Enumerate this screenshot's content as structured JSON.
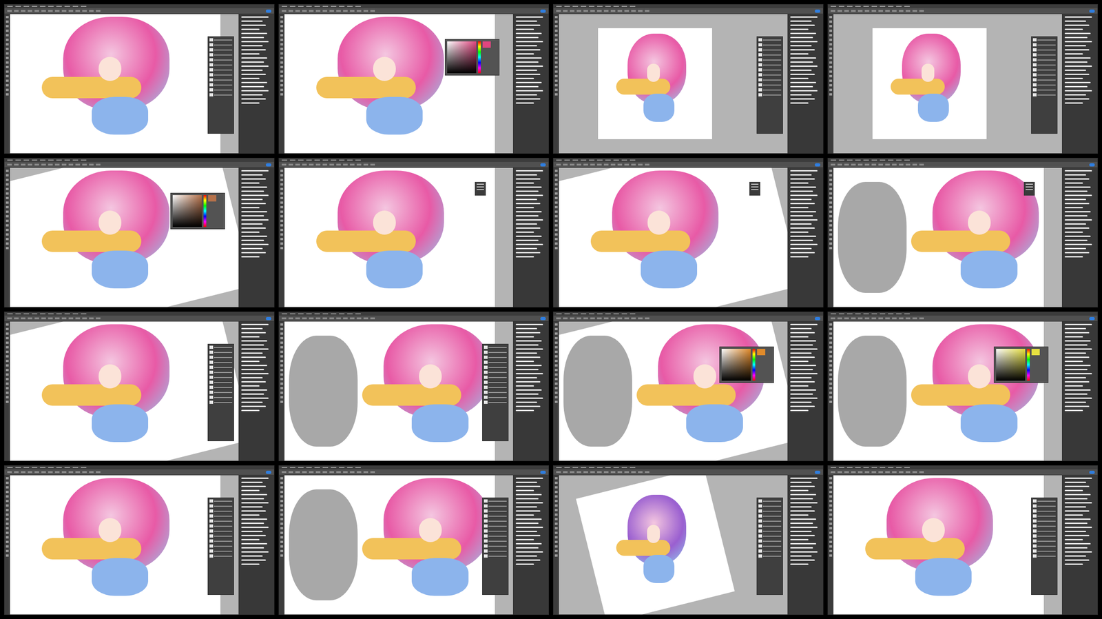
{
  "tiles": [
    {
      "view": "close",
      "rotated": false,
      "kind": "layers",
      "reference_visible": false,
      "color": "#e85aa6"
    },
    {
      "view": "close",
      "rotated": false,
      "kind": "color-picker",
      "reference_visible": false,
      "color": "#e85aa6",
      "swatch": "#e0457f"
    },
    {
      "view": "fit",
      "rotated": false,
      "kind": "layers",
      "reference_visible": false,
      "color": "#e85aa6"
    },
    {
      "view": "fit",
      "rotated": false,
      "kind": "layers",
      "reference_visible": false,
      "color": "#e85aa6"
    },
    {
      "view": "close",
      "rotated": true,
      "kind": "color-picker",
      "reference_visible": false,
      "color": "#e85aa6",
      "swatch": "#b5714a"
    },
    {
      "view": "close",
      "rotated": false,
      "kind": "menu",
      "reference_visible": false,
      "color": "#e85aa6"
    },
    {
      "view": "close",
      "rotated": true,
      "kind": "menu",
      "reference_visible": false,
      "color": "#e85aa6"
    },
    {
      "view": "close",
      "rotated": false,
      "kind": "menu",
      "reference_visible": true,
      "color": "#e85aa6"
    },
    {
      "view": "close",
      "rotated": true,
      "kind": "layers",
      "reference_visible": false,
      "color": "#e85aa6"
    },
    {
      "view": "close",
      "rotated": false,
      "kind": "layers",
      "reference_visible": true,
      "color": "#e85aa6"
    },
    {
      "view": "close",
      "rotated": true,
      "kind": "color-picker",
      "reference_visible": true,
      "color": "#e85aa6",
      "swatch": "#e08a2a"
    },
    {
      "view": "close",
      "rotated": false,
      "kind": "color-picker",
      "reference_visible": true,
      "color": "#e85aa6",
      "swatch": "#e6e040"
    },
    {
      "view": "close",
      "rotated": false,
      "kind": "layers",
      "reference_visible": false,
      "color": "#e85aa6"
    },
    {
      "view": "close",
      "rotated": false,
      "kind": "layers",
      "reference_visible": true,
      "color": "#e85aa6"
    },
    {
      "view": "fit",
      "rotated": true,
      "kind": "layers",
      "reference_visible": false,
      "color": "#9a5fd0"
    },
    {
      "view": "close",
      "rotated": false,
      "kind": "layers",
      "reference_visible": false,
      "color": "#e85aa6"
    }
  ]
}
